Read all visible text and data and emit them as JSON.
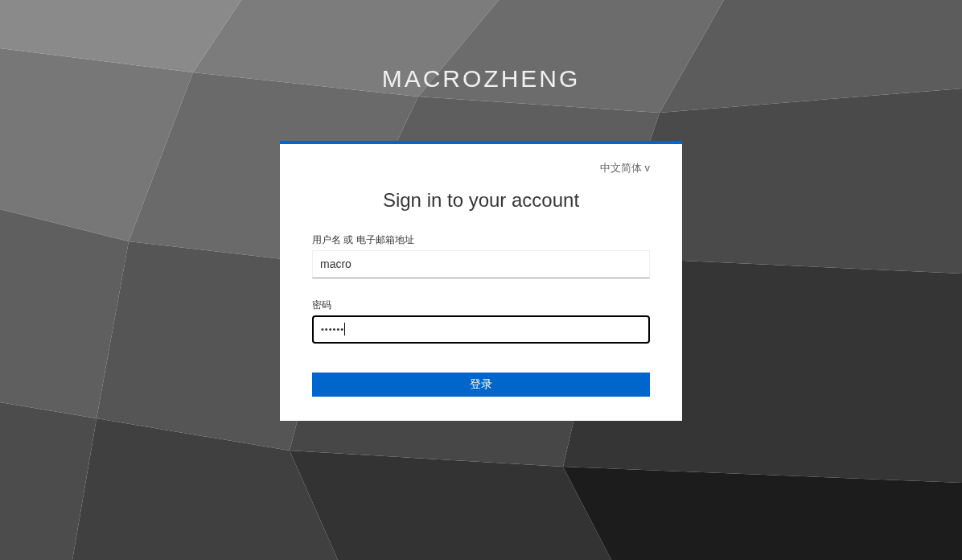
{
  "brand": "MACROZHENG",
  "login_card": {
    "language": {
      "label": "中文简体",
      "caret": "v"
    },
    "title": "Sign in to your account",
    "fields": [
      {
        "kind": "text",
        "label": "用户名 或 电子邮箱地址",
        "value": "macro",
        "focused": false
      },
      {
        "kind": "password",
        "label": "密码",
        "value": "••••••",
        "focused": true
      }
    ],
    "submit_button": "登录"
  }
}
